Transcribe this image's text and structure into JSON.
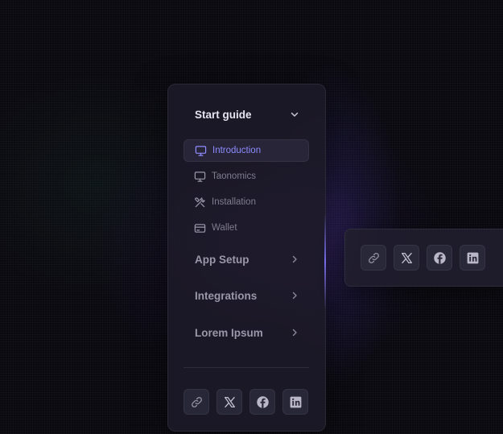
{
  "sidebar": {
    "sections": [
      {
        "title": "Start guide",
        "expanded": true,
        "chevron": "chevron-down-icon"
      },
      {
        "title": "App Setup",
        "expanded": false,
        "chevron": "chevron-right-icon"
      },
      {
        "title": "Integrations",
        "expanded": false,
        "chevron": "chevron-right-icon"
      },
      {
        "title": "Lorem Ipsum",
        "expanded": false,
        "chevron": "chevron-right-icon"
      }
    ],
    "start_guide_items": [
      {
        "label": "Introduction",
        "icon": "monitor-icon",
        "selected": true
      },
      {
        "label": "Taonomics",
        "icon": "monitor-icon",
        "selected": false
      },
      {
        "label": "Installation",
        "icon": "tools-icon",
        "selected": false
      },
      {
        "label": "Wallet",
        "icon": "card-icon",
        "selected": false
      }
    ]
  },
  "social": [
    {
      "icon": "link-icon"
    },
    {
      "icon": "x-icon"
    },
    {
      "icon": "facebook-icon"
    },
    {
      "icon": "linkedin-icon"
    }
  ],
  "colors": {
    "background": "#0a0910",
    "panel": "#1c1a28",
    "accent": "#8e8cff",
    "text_active": "#e4e3ee",
    "text_muted": "#7f7d8e",
    "icon_muted": "#9a98aa"
  }
}
